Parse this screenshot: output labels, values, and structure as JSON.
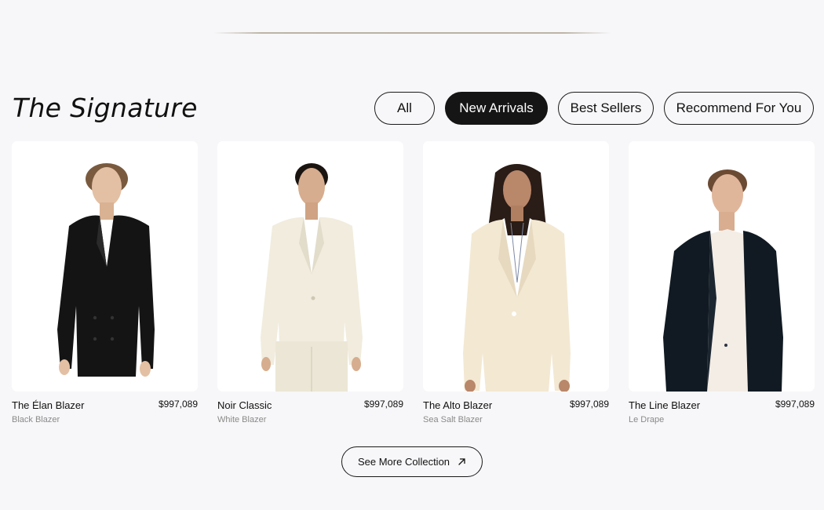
{
  "section": {
    "title": "The Signature"
  },
  "filters": [
    {
      "label": "All",
      "active": false
    },
    {
      "label": "New Arrivals",
      "active": true
    },
    {
      "label": "Best Sellers",
      "active": false
    },
    {
      "label": "Recommend For You",
      "active": false
    }
  ],
  "products": [
    {
      "name": "The Élan Blazer",
      "price": "$997,089",
      "subtitle": "Black Blazer",
      "jacket_color": "#141414"
    },
    {
      "name": "Noir Classic",
      "price": "$997,089",
      "subtitle": "White Blazer",
      "jacket_color": "#f1ecdd"
    },
    {
      "name": "The Alto Blazer",
      "price": "$997,089",
      "subtitle": "Sea Salt Blazer",
      "jacket_color": "#f3e8d2"
    },
    {
      "name": "The Line Blazer",
      "price": "$997,089",
      "subtitle": "Le Drape",
      "jacket_color": "#111a22"
    }
  ],
  "cta": {
    "label": "See More Collection",
    "icon": "arrow-up-right-icon"
  },
  "colors": {
    "background": "#f7f7f9",
    "accent": "#151515",
    "divider": "#bdb4a6"
  }
}
